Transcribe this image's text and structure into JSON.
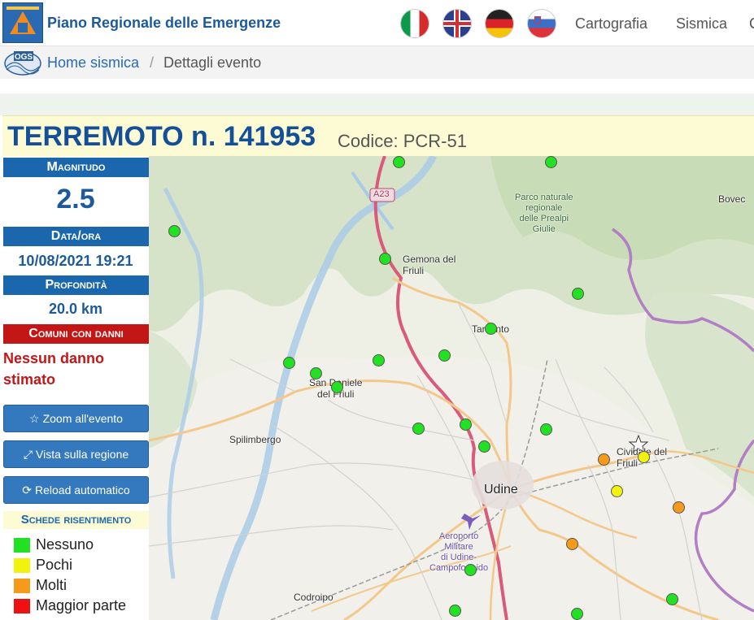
{
  "navbar": {
    "title": "Piano Regionale delle Emergenze",
    "flags": [
      "flag-italy-icon",
      "flag-uk-icon",
      "flag-germany-icon",
      "flag-slovenia-icon"
    ],
    "links": [
      "Cartografia",
      "Sismica",
      "C"
    ]
  },
  "breadcrumb": {
    "logo_text": "OGS",
    "home": "Home sismica",
    "separator": "/",
    "current": "Dettagli evento"
  },
  "event": {
    "title": "TERREMOTO n. 141953",
    "code": "Codice: PCR-51"
  },
  "panel": {
    "magnitude_label": "Magnitudo",
    "magnitude": "2.5",
    "datetime_label": "Data/ora",
    "datetime": "10/08/2021 19:21",
    "depth_label": "Profondità",
    "depth": "20.0 km",
    "damage_label": "Comuni con danni",
    "damage_text": "Nessun danno stimato",
    "buttons": {
      "zoom": "Zoom all'evento",
      "region": "Vista sulla regione",
      "reload": "Reload automatico"
    },
    "legend_title": "Schede risentimento",
    "legend": [
      {
        "label": "Nessuno",
        "color": "#22e022"
      },
      {
        "label": "Pochi",
        "color": "#f2f20f"
      },
      {
        "label": "Molti",
        "color": "#f59a1a"
      },
      {
        "label": "Maggior parte",
        "color": "#ee1111"
      }
    ]
  },
  "map": {
    "labels": {
      "a23": "A23",
      "park": "Parco naturale\nregionale\ndelle Prealpi\nGiulie",
      "bovec": "Bovec",
      "gemona": "Gemona del\nFriuli",
      "tarcento": "Tarcento",
      "san_daniele": "San Daniele\ndel Friuli",
      "spilimbergo": "Spilimbergo",
      "cividale": "Cividale del\nFriuli",
      "udine": "Udine",
      "airport": "Aeroporto\nMilitare\ndi Udine-\nCampoformido",
      "codroipo": "Codroipo"
    }
  }
}
